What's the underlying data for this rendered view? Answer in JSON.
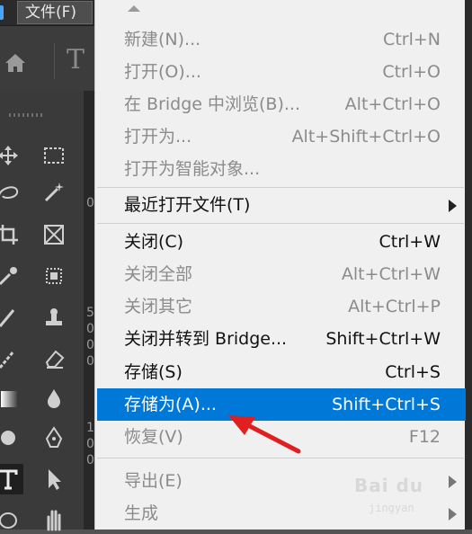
{
  "menubar": {
    "file_menu_label": "文件(F)"
  },
  "file_menu": {
    "items": [
      {
        "label": "新建(N)...",
        "shortcut": "Ctrl+N"
      },
      {
        "label": "打开(O)...",
        "shortcut": "Ctrl+O"
      },
      {
        "label": "在 Bridge 中浏览(B)...",
        "shortcut": "Alt+Ctrl+O"
      },
      {
        "label": "打开为...",
        "shortcut": "Alt+Shift+Ctrl+O"
      },
      {
        "label": "打开为智能对象...",
        "shortcut": ""
      },
      {
        "label": "最近打开文件(T)",
        "shortcut": ""
      },
      {
        "label": "关闭(C)",
        "shortcut": "Ctrl+W"
      },
      {
        "label": "关闭全部",
        "shortcut": "Alt+Ctrl+W"
      },
      {
        "label": "关闭其它",
        "shortcut": "Alt+Ctrl+P"
      },
      {
        "label": "关闭并转到 Bridge...",
        "shortcut": "Shift+Ctrl+W"
      },
      {
        "label": "存储(S)",
        "shortcut": "Ctrl+S"
      },
      {
        "label": "存储为(A)...",
        "shortcut": "Shift+Ctrl+S"
      },
      {
        "label": "恢复(V)",
        "shortcut": "F12"
      },
      {
        "label": "导出(E)",
        "shortcut": ""
      },
      {
        "label": "生成",
        "shortcut": ""
      }
    ]
  },
  "doc_digits": [
    "0",
    "5",
    "0",
    "0",
    "0",
    "1",
    "0",
    "0"
  ],
  "options_bar": {
    "type_glyph": "T"
  },
  "watermark": {
    "text": "Bai du",
    "sub": "jingyan"
  },
  "colors": {
    "highlight": "#0078d7",
    "menu_bg": "#f0f0f0",
    "disabled_text": "#8b8b8b",
    "arrow_red": "#e02020"
  },
  "icons": [
    "home-icon",
    "move-icon",
    "marquee-icon",
    "lasso-icon",
    "magic-wand-icon",
    "crop-icon",
    "frame-icon",
    "eyedropper-icon",
    "healing-icon",
    "brush-icon",
    "stamp-icon",
    "history-brush-icon",
    "eraser-icon",
    "gradient-icon",
    "blur-drop-icon",
    "dodge-icon",
    "pen-icon",
    "type-tool-icon",
    "path-selection-icon",
    "shape-icon",
    "hand-icon"
  ]
}
